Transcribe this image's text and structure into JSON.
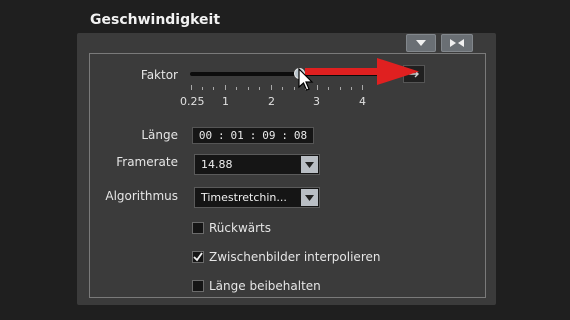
{
  "header": {
    "title": "Geschwindigkeit"
  },
  "faktor": {
    "label": "Faktor",
    "tick_labels": [
      "0.25",
      "1",
      "2",
      "3",
      "4"
    ],
    "value_fraction": 0.53
  },
  "laenge": {
    "label": "Länge",
    "timecode": [
      "00",
      "01",
      "09",
      "08"
    ],
    "separator": ":"
  },
  "framerate": {
    "label": "Framerate",
    "value": "14.88"
  },
  "algorithmus": {
    "label": "Algorithmus",
    "value": "Timestretchin..."
  },
  "options": [
    {
      "label": "Rückwärts",
      "checked": false
    },
    {
      "label": "Zwischenbilder interpolieren",
      "checked": true
    },
    {
      "label": "Länge beibehalten",
      "checked": false
    }
  ],
  "colors": {
    "panel": "#3b3b3b",
    "background": "#1f1f1f",
    "annotation_arrow": "#e02020"
  },
  "icons": [
    "chevron-down-icon",
    "collapse-icon",
    "reset-icon",
    "mouse-cursor-icon"
  ]
}
